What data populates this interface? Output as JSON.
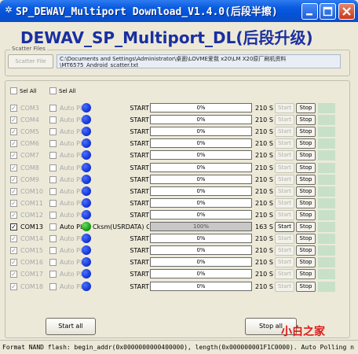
{
  "window": {
    "title": "SP_DEWAV_Multiport Download_V1.4.0(后段半擦)"
  },
  "app_heading": "DEWAV_SP_Multiport_DL(后段升级)",
  "scatter": {
    "group_label": "Scatter Files",
    "button_label": "Scatter File",
    "path_line1": "C:\\Documents and Settings\\Administrator\\桌面\\LOVME爱我 x20\\LM X20原厂刷机资料",
    "path_line2": "\\MT6575_Android_scatter.txt"
  },
  "select_all": {
    "left_label": "Sel All",
    "right_label": "Sel All"
  },
  "ports": [
    {
      "com": "COM3",
      "auto": "Auto PL",
      "status": "START",
      "progress": "0%",
      "time": "210 S",
      "start": "Start",
      "stop": "Stop",
      "active": false
    },
    {
      "com": "COM4",
      "auto": "Auto PL",
      "status": "START",
      "progress": "0%",
      "time": "210 S",
      "start": "Start",
      "stop": "Stop",
      "active": false
    },
    {
      "com": "COM5",
      "auto": "Auto PL",
      "status": "START",
      "progress": "0%",
      "time": "210 S",
      "start": "Start",
      "stop": "Stop",
      "active": false
    },
    {
      "com": "COM6",
      "auto": "Auto PL",
      "status": "START",
      "progress": "0%",
      "time": "210 S",
      "start": "Start",
      "stop": "Stop",
      "active": false
    },
    {
      "com": "COM7",
      "auto": "Auto PL",
      "status": "START",
      "progress": "0%",
      "time": "210 S",
      "start": "Start",
      "stop": "Stop",
      "active": false
    },
    {
      "com": "COM8",
      "auto": "Auto PL",
      "status": "START",
      "progress": "0%",
      "time": "210 S",
      "start": "Start",
      "stop": "Stop",
      "active": false
    },
    {
      "com": "COM9",
      "auto": "Auto PL",
      "status": "START",
      "progress": "0%",
      "time": "210 S",
      "start": "Start",
      "stop": "Stop",
      "active": false
    },
    {
      "com": "COM10",
      "auto": "Auto PL",
      "status": "START",
      "progress": "0%",
      "time": "210 S",
      "start": "Start",
      "stop": "Stop",
      "active": false
    },
    {
      "com": "COM11",
      "auto": "Auto PL",
      "status": "START",
      "progress": "0%",
      "time": "210 S",
      "start": "Start",
      "stop": "Stop",
      "active": false
    },
    {
      "com": "COM12",
      "auto": "Auto PL",
      "status": "START",
      "progress": "0%",
      "time": "210 S",
      "start": "Start",
      "stop": "Stop",
      "active": false
    },
    {
      "com": "COM13",
      "auto": "Auto PL",
      "status": "Cksm(USRDATA) OK",
      "progress": "100%",
      "time": "163 S",
      "start": "Start",
      "stop": "Stop",
      "active": true
    },
    {
      "com": "COM14",
      "auto": "Auto PL",
      "status": "START",
      "progress": "0%",
      "time": "210 S",
      "start": "Start",
      "stop": "Stop",
      "active": false
    },
    {
      "com": "COM15",
      "auto": "Auto PL",
      "status": "START",
      "progress": "0%",
      "time": "210 S",
      "start": "Start",
      "stop": "Stop",
      "active": false
    },
    {
      "com": "COM16",
      "auto": "Auto PL",
      "status": "START",
      "progress": "0%",
      "time": "210 S",
      "start": "Start",
      "stop": "Stop",
      "active": false
    },
    {
      "com": "COM17",
      "auto": "Auto PL",
      "status": "START",
      "progress": "0%",
      "time": "210 S",
      "start": "Start",
      "stop": "Stop",
      "active": false
    },
    {
      "com": "COM18",
      "auto": "Auto PL",
      "status": "START",
      "progress": "0%",
      "time": "210 S",
      "start": "Start",
      "stop": "Stop",
      "active": false
    }
  ],
  "buttons": {
    "start_all": "Start all",
    "stop_all": "Stop all"
  },
  "watermark": "小白之家",
  "status_bar": "Format NAND flash:  begin_addr(0x0000000000400000), length(0x000000001F1C0000). Auto Polling n",
  "colors": {
    "title_bar": "#0553d8",
    "heading": "#1a2fa0",
    "dot_idle": "#1030d0",
    "dot_active": "#129010",
    "watermark": "#e01818"
  }
}
